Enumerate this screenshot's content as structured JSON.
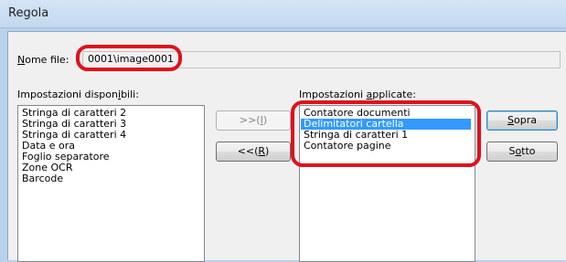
{
  "window": {
    "title": "Regola"
  },
  "file": {
    "label_accel": "N",
    "label_rest": "ome file:",
    "value": "0001\\image0001"
  },
  "available": {
    "label_pre": "Impostazioni dispon",
    "label_accel": "i",
    "label_post": "bili:",
    "items": [
      "Stringa di caratteri 2",
      "Stringa di caratteri 3",
      "Stringa di caratteri 4",
      "Data e ora",
      "Foglio separatore",
      "Zone OCR",
      "Barcode"
    ]
  },
  "applied": {
    "label_pre": "Impostazioni ",
    "label_accel": "a",
    "label_post": "pplicate:",
    "items": [
      "Contatore documenti",
      "Delimitatori cartella",
      "Stringa di caratteri 1",
      "Contatore pagine"
    ],
    "selected_index": 1
  },
  "buttons": {
    "add_pre": ">>(",
    "add_accel": "I",
    "add_post": ")",
    "remove_pre": "<<(",
    "remove_accel": "R",
    "remove_post": ")",
    "up_accel": "S",
    "up_rest": "opra",
    "down_pre": "S",
    "down_accel": "o",
    "down_post": "tto"
  },
  "colors": {
    "highlight_ring": "#e0101b",
    "selection": "#3399ff"
  }
}
